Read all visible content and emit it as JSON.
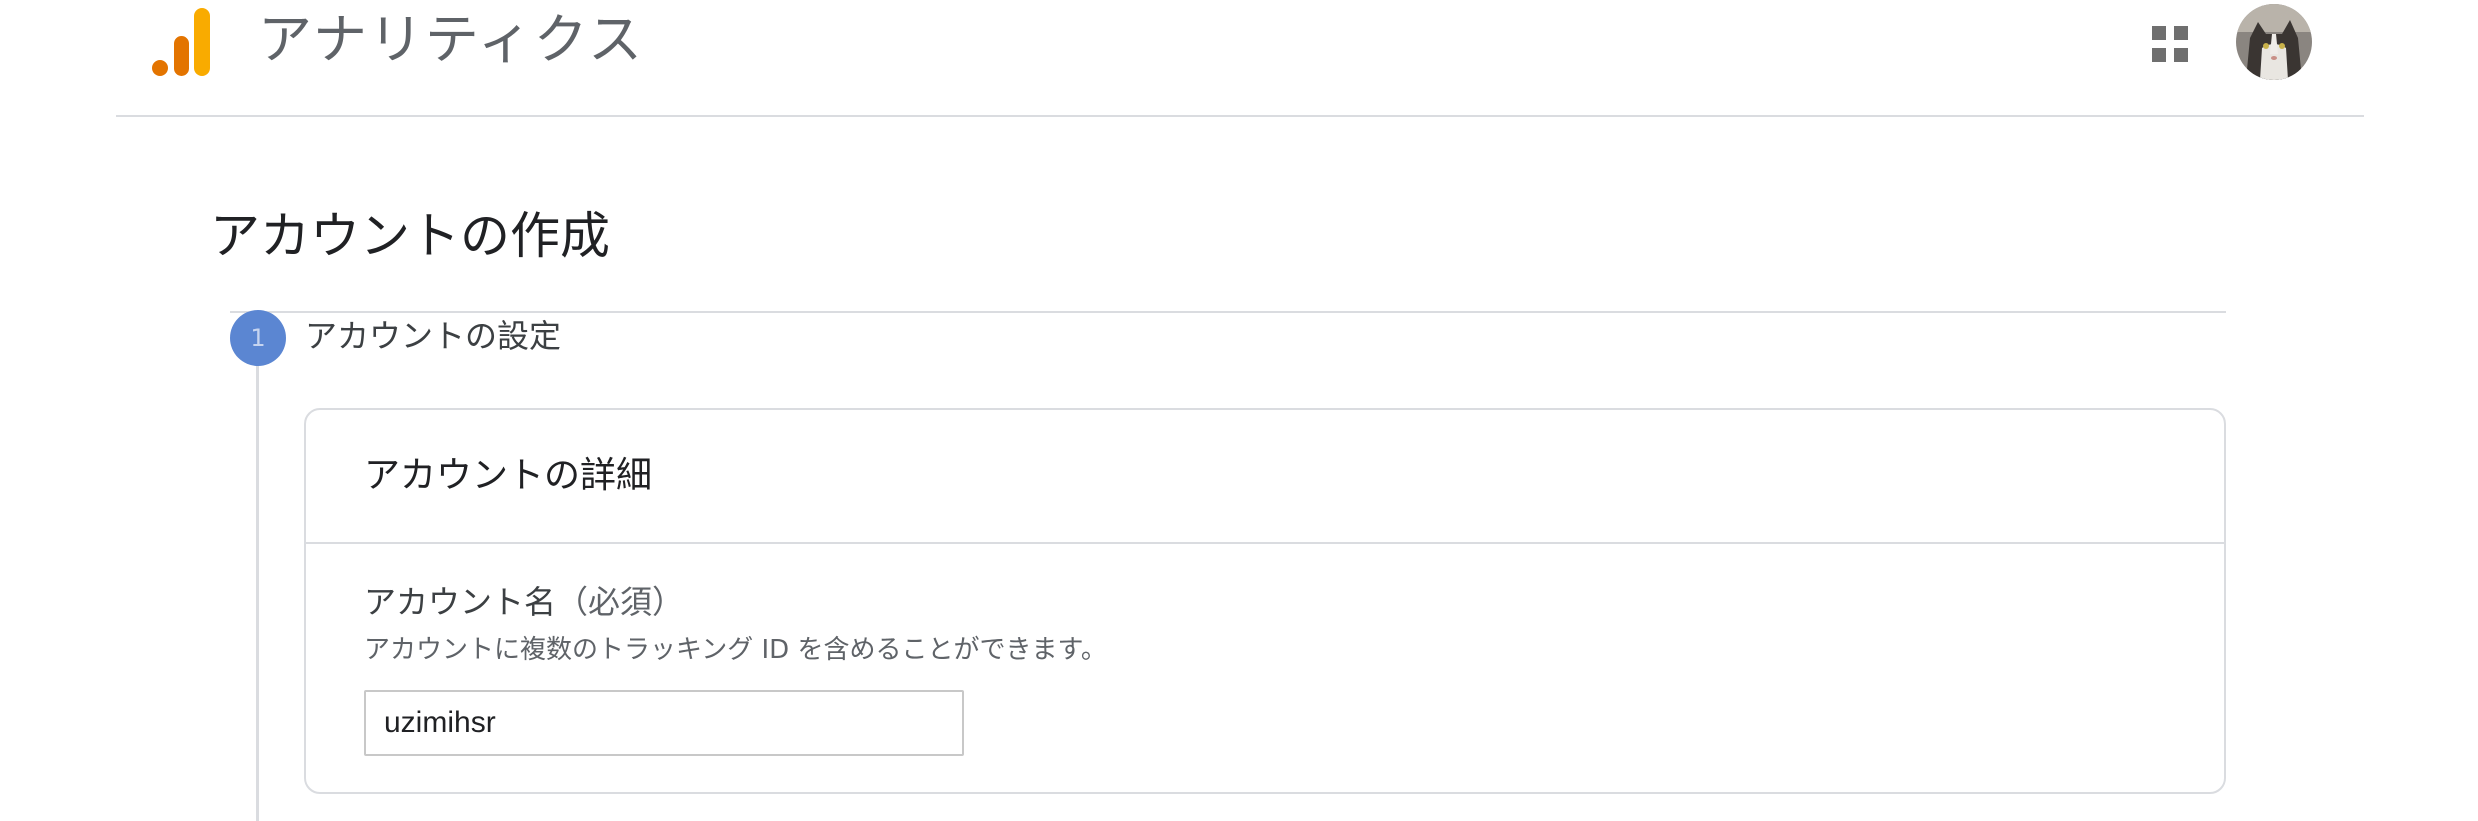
{
  "header": {
    "app_title": "アナリティクス",
    "logo_icon": "analytics-bars-icon",
    "apps_icon": "apps-grid-icon",
    "avatar_icon": "cat-avatar",
    "colors": {
      "logo_dark": "#e37400",
      "logo_light": "#f9ab00",
      "icon_gray": "#5f6368"
    }
  },
  "page": {
    "title": "アカウントの作成"
  },
  "stepper": {
    "step_number": "1",
    "step_label": "アカウントの設定",
    "step_color": "#5b86d2"
  },
  "card": {
    "title": "アカウントの詳細",
    "field_label": "アカウント名",
    "field_required": "（必須）",
    "field_hint": "アカウントに複数のトラッキング ID を含めることができます。",
    "field_value": "uzimihsr"
  }
}
